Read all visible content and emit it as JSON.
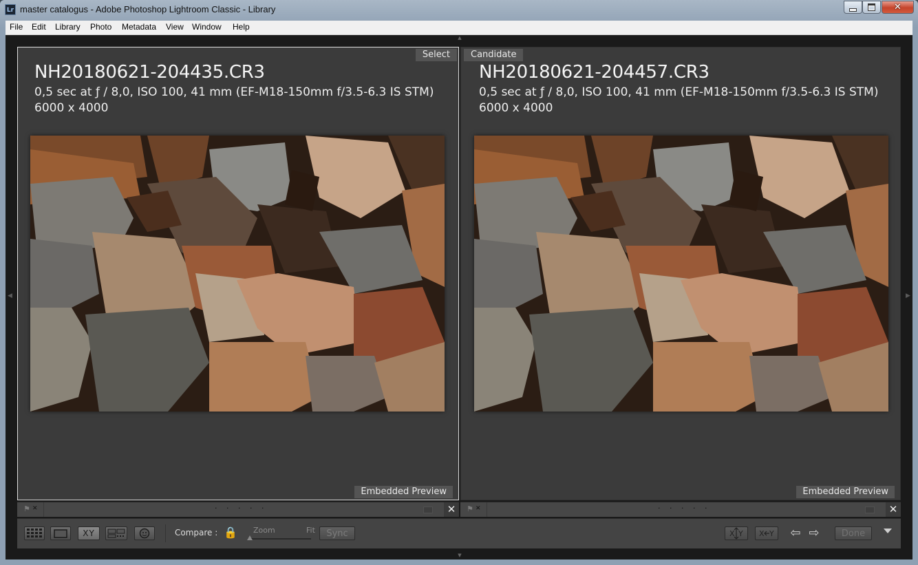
{
  "window": {
    "title": "master catalogus - Adobe Photoshop Lightroom Classic - Library",
    "app_icon_label": "Lr",
    "controls": [
      "minimize",
      "maximize",
      "close"
    ]
  },
  "menu": [
    "File",
    "Edit",
    "Library",
    "Photo",
    "Metadata",
    "View",
    "Window",
    "Help"
  ],
  "panes": [
    {
      "tag": "Select",
      "filename": "NH20180621-204435.CR3",
      "exif": "0,5 sec at ƒ / 8,0, ISO 100, 41 mm (EF-M18-150mm f/3.5-6.3 IS STM)",
      "dimensions": "6000 x 4000",
      "preview_label": "Embedded Preview"
    },
    {
      "tag": "Candidate",
      "filename": "NH20180621-204457.CR3",
      "exif": "0,5 sec at ƒ / 8,0, ISO 100, 41 mm (EF-M18-150mm f/3.5-6.3 IS STM)",
      "dimensions": "6000 x 4000",
      "preview_label": "Embedded Preview"
    }
  ],
  "strips": [
    {
      "dots": "· · · · ·",
      "close": "✕"
    },
    {
      "dots": "· · · · ·",
      "close": "✕"
    }
  ],
  "toolbar": {
    "compare_label": "Compare :",
    "zoom_label": "Zoom",
    "fit_label": "Fit",
    "sync_label": "Sync",
    "done_label": "Done",
    "xy_label": "XY",
    "prev_arrow": "⇦",
    "next_arrow": "⇨"
  },
  "colors": {
    "panel_bg": "#3b3b3b",
    "chrome_bg": "#1a1a1a",
    "lock_accent": "#caa845"
  }
}
